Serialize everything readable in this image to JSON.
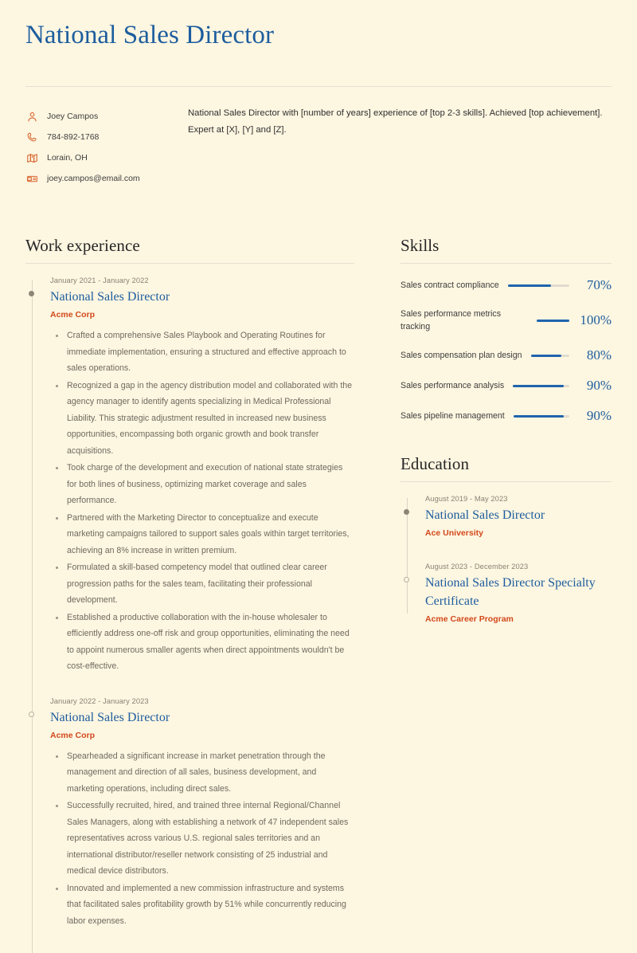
{
  "theme": {
    "background": "#fdf6e1",
    "accent_blue": "#1d5d9e",
    "accent_orange": "#d2491b",
    "icon_orange": "#d9622b",
    "muted_text": "#6f6a60",
    "rule": "#e6ded0"
  },
  "header": {
    "title": "National Sales Director"
  },
  "contact": {
    "items": [
      {
        "icon": "person-icon",
        "text": "Joey Campos"
      },
      {
        "icon": "phone-icon",
        "text": "784-892-1768"
      },
      {
        "icon": "map-icon",
        "text": "Lorain, OH"
      },
      {
        "icon": "mailbox-icon",
        "text": "joey.campos@email.com"
      }
    ]
  },
  "summary": {
    "text": "National Sales Director with [number of years] experience of [top 2-3 skills]. Achieved [top achievement]. Expert at [X], [Y] and [Z]."
  },
  "work_experience": {
    "heading": "Work experience",
    "entries": [
      {
        "date": "January 2021 - January 2022",
        "role": "National Sales Director",
        "org": "Acme Corp",
        "marker": "filled",
        "bullets": [
          "Crafted a comprehensive Sales Playbook and Operating Routines for immediate implementation, ensuring a structured and effective approach to sales operations.",
          "Recognized a gap in the agency distribution model and collaborated with the agency manager to identify agents specializing in Medical Professional Liability. This strategic adjustment resulted in increased new business opportunities, encompassing both organic growth and book transfer acquisitions.",
          "Took charge of the development and execution of national state strategies for both lines of business, optimizing market coverage and sales performance.",
          "Partnered with the Marketing Director to conceptualize and execute marketing campaigns tailored to support sales goals within target territories, achieving an 8% increase in written premium.",
          "Formulated a skill-based competency model that outlined clear career progression paths for the sales team, facilitating their professional development.",
          "Established a productive collaboration with the in-house wholesaler to efficiently address one-off risk and group opportunities, eliminating the need to appoint numerous smaller agents when direct appointments wouldn't be cost-effective."
        ]
      },
      {
        "date": "January 2022 - January 2023",
        "role": "National Sales Director",
        "org": "Acme Corp",
        "marker": "hollow",
        "bullets": [
          "Spearheaded a significant increase in market penetration through the management and direction of all sales, business development, and marketing operations, including direct sales.",
          "Successfully recruited, hired, and trained three internal Regional/Channel Sales Managers, along with establishing a network of 47 independent sales representatives across various U.S. regional sales territories and an international distributor/reseller network consisting of 25 industrial and medical device distributors.",
          "Innovated and implemented a new commission infrastructure and systems that facilitated sales profitability growth by 51% while concurrently reducing labor expenses."
        ]
      }
    ]
  },
  "skills": {
    "heading": "Skills",
    "items": [
      {
        "name": "Sales contract compliance",
        "percent": 70,
        "percent_label": "70%"
      },
      {
        "name": "Sales performance metrics tracking",
        "percent": 100,
        "percent_label": "100%"
      },
      {
        "name": "Sales compensation plan design",
        "percent": 80,
        "percent_label": "80%"
      },
      {
        "name": "Sales performance analysis",
        "percent": 90,
        "percent_label": "90%"
      },
      {
        "name": "Sales pipeline management",
        "percent": 90,
        "percent_label": "90%"
      }
    ]
  },
  "education": {
    "heading": "Education",
    "entries": [
      {
        "date": "August 2019 - May 2023",
        "degree": "National Sales Director",
        "org": "Ace University",
        "marker": "filled"
      },
      {
        "date": "August 2023 - December 2023",
        "degree": "National Sales Director Specialty Certificate",
        "org": "Acme Career Program",
        "marker": "hollow"
      }
    ]
  }
}
